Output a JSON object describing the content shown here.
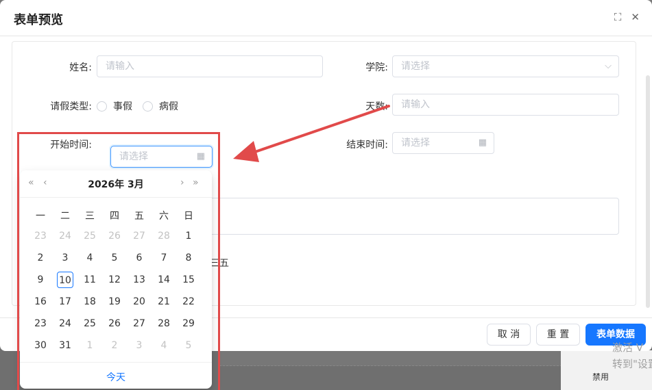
{
  "dialog": {
    "title": "表单预览"
  },
  "form": {
    "name_label": "姓名:",
    "name_placeholder": "请输入",
    "college_label": "学院:",
    "college_placeholder": "请选择",
    "leave_type_label": "请假类型:",
    "leave_options": [
      "事假",
      "病假"
    ],
    "days_label": "天数:",
    "days_placeholder": "请输入",
    "start_label": "开始时间:",
    "start_placeholder": "请选择",
    "end_label": "结束时间:",
    "end_placeholder": "请选择",
    "partial_text": "三五"
  },
  "calendar": {
    "title": "2026年  3月",
    "weekdays": [
      "一",
      "二",
      "三",
      "四",
      "五",
      "六",
      "日"
    ],
    "weeks": [
      [
        {
          "d": "23",
          "o": true
        },
        {
          "d": "24",
          "o": true
        },
        {
          "d": "25",
          "o": true
        },
        {
          "d": "26",
          "o": true
        },
        {
          "d": "27",
          "o": true
        },
        {
          "d": "28",
          "o": true
        },
        {
          "d": "1",
          "o": false
        }
      ],
      [
        {
          "d": "2",
          "o": false
        },
        {
          "d": "3",
          "o": false
        },
        {
          "d": "4",
          "o": false
        },
        {
          "d": "5",
          "o": false
        },
        {
          "d": "6",
          "o": false
        },
        {
          "d": "7",
          "o": false
        },
        {
          "d": "8",
          "o": false
        }
      ],
      [
        {
          "d": "9",
          "o": false
        },
        {
          "d": "10",
          "o": false,
          "today": true
        },
        {
          "d": "11",
          "o": false
        },
        {
          "d": "12",
          "o": false
        },
        {
          "d": "13",
          "o": false
        },
        {
          "d": "14",
          "o": false
        },
        {
          "d": "15",
          "o": false
        }
      ],
      [
        {
          "d": "16",
          "o": false
        },
        {
          "d": "17",
          "o": false
        },
        {
          "d": "18",
          "o": false
        },
        {
          "d": "19",
          "o": false
        },
        {
          "d": "20",
          "o": false
        },
        {
          "d": "21",
          "o": false
        },
        {
          "d": "22",
          "o": false
        }
      ],
      [
        {
          "d": "23",
          "o": false
        },
        {
          "d": "24",
          "o": false
        },
        {
          "d": "25",
          "o": false
        },
        {
          "d": "26",
          "o": false
        },
        {
          "d": "27",
          "o": false
        },
        {
          "d": "28",
          "o": false
        },
        {
          "d": "29",
          "o": false
        }
      ],
      [
        {
          "d": "30",
          "o": false
        },
        {
          "d": "31",
          "o": false
        },
        {
          "d": "1",
          "o": true
        },
        {
          "d": "2",
          "o": true
        },
        {
          "d": "3",
          "o": true
        },
        {
          "d": "4",
          "o": true
        },
        {
          "d": "5",
          "o": true
        }
      ]
    ],
    "today_label": "今天"
  },
  "footer": {
    "cancel": "取 消",
    "reset": "重 置",
    "submit": "表单数据"
  },
  "background": {
    "disable_label": "禁用",
    "watermark": "激活 V\n转到\"设置"
  },
  "icons": {
    "expand": "expand-icon",
    "close": "close-icon",
    "calendar": "calendar-icon",
    "chevron": "chevron-down-icon"
  },
  "colors": {
    "primary": "#1677ff",
    "annotation": "#e14a4a"
  }
}
